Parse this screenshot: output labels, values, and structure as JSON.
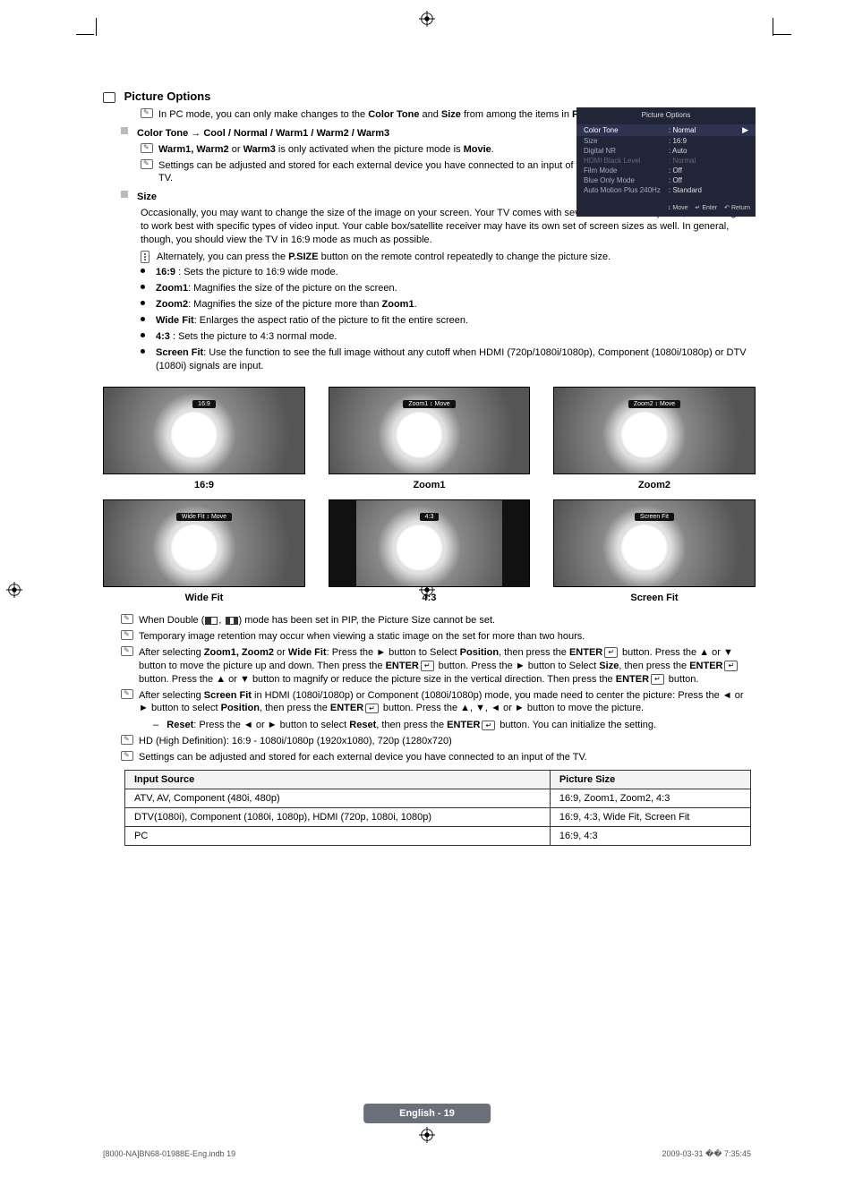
{
  "heading": "Picture Options",
  "intro_note": {
    "pre": "In PC mode, you can only make changes to the ",
    "b1": "Color Tone",
    "mid": " and ",
    "b2": "Size",
    "post": " from among the items in ",
    "b3": "Picture Options",
    "end": "."
  },
  "color_tone_heading": "Color Tone → Cool / Normal / Warm1 / Warm2 / Warm3",
  "ct_note1": {
    "b": "Warm1, Warm2",
    "mid": " or ",
    "b2": "Warm3",
    "post": " is only activated when the picture mode is ",
    "b3": "Movie",
    "end": "."
  },
  "ct_note2": "Settings can be adjusted and stored for each external device you have connected to an input of the TV.",
  "size_heading": "Size",
  "size_para": "Occasionally, you may want to change the size of the image on your screen. Your TV comes with several screen size options, each designed to work best with specific types of video input. Your cable box/satellite receiver may have its own set of screen sizes as well. In general, though, you should view the TV in 16:9 mode as much as possible.",
  "size_remote": {
    "pre": "Alternately, you can press the ",
    "b": "P.SIZE",
    "post": " button on the remote control repeatedly to change the picture size."
  },
  "bullets": [
    {
      "b": "16:9",
      "t": " : Sets the picture to 16:9 wide mode."
    },
    {
      "b": "Zoom1",
      "t": ": Magnifies the size of the picture on the screen."
    },
    {
      "b": "Zoom2",
      "t": ": Magnifies the size of the picture more than ",
      "b2": "Zoom1",
      "t2": "."
    },
    {
      "b": "Wide Fit",
      "t": ": Enlarges the aspect ratio of the picture to fit the entire screen."
    },
    {
      "b": "4:3",
      "t": " : Sets the picture to 4:3 normal mode."
    },
    {
      "b": "Screen Fit",
      "t": ": Use the function to see the full image without any cutoff when HDMI (720p/1080i/1080p), Component (1080i/1080p) or DTV (1080i) signals are input."
    }
  ],
  "thumbs": [
    [
      {
        "badge": "16:9",
        "cap": "16:9",
        "narrow": false
      },
      {
        "badge": "Zoom1 ↕ Move",
        "cap": "Zoom1",
        "narrow": false
      },
      {
        "badge": "Zoom2 ↕ Move",
        "cap": "Zoom2",
        "narrow": false
      }
    ],
    [
      {
        "badge": "Wide Fit ↕ Move",
        "cap": "Wide Fit",
        "narrow": false
      },
      {
        "badge": "4:3",
        "cap": "4:3",
        "narrow": true
      },
      {
        "badge": "Screen Fit",
        "cap": "Screen Fit",
        "narrow": false
      }
    ]
  ],
  "notes": {
    "n1_a": "When Double (",
    "n1_b": ") mode has been set in PIP, the Picture Size cannot be set.",
    "n2": "Temporary image retention may occur when viewing a static image on the set for more than two hours.",
    "n3_a": "After selecting ",
    "n3_b": "Zoom1, Zoom2",
    "n3_c": " or ",
    "n3_d": "Wide Fit",
    "n3_e": ": Press the ► button to Select ",
    "n3_f": "Position",
    "n3_g": ", then press the ",
    "n3_h": "ENTER",
    "n3_i": " button. Press the ▲ or ▼ button to move the picture up and down. Then press the ",
    "n3_j": " button. Press the ► button to Select ",
    "n3_k": "Size",
    "n3_l": ", then press the ",
    "n3_m": " button. Press the ▲ or ▼ button to magnify or reduce the picture size in the vertical direction. Then press the ",
    "n3_n": " button.",
    "n4_a": "After selecting ",
    "n4_b": "Screen Fit",
    "n4_c": " in HDMI (1080i/1080p) or Component (1080i/1080p) mode, you made need to center the picture: Press the ◄ or ► button to select ",
    "n4_d": "Position",
    "n4_e": ", then press the ",
    "n4_f": " button. Press the ▲, ▼, ◄ or ► button to move the picture.",
    "reset_a": "Reset",
    "reset_b": ": Press the ◄ or ► button to select ",
    "reset_c": "Reset",
    "reset_d": ", then press the ",
    "reset_e": " button. You can initialize the setting.",
    "n5": "HD (High Definition): 16:9 - 1080i/1080p (1920x1080), 720p (1280x720)",
    "n6": "Settings can be adjusted and stored for each external device you have connected to an input of the TV."
  },
  "table": {
    "h1": "Input Source",
    "h2": "Picture Size",
    "rows": [
      {
        "a": "ATV, AV, Component (480i, 480p)",
        "b": "16:9, Zoom1, Zoom2, 4:3"
      },
      {
        "a": "DTV(1080i), Component (1080i, 1080p), HDMI (720p, 1080i, 1080p)",
        "b": "16:9, 4:3, Wide Fit, Screen Fit"
      },
      {
        "a": "PC",
        "b": "16:9, 4:3"
      }
    ]
  },
  "menu": {
    "title": "Picture Options",
    "rows": [
      {
        "label": "Color Tone",
        "val": ": Normal",
        "sel": true,
        "dis": false
      },
      {
        "label": "Size",
        "val": ": 16:9",
        "sel": false,
        "dis": false
      },
      {
        "label": "Digital NR",
        "val": ": Auto",
        "sel": false,
        "dis": false
      },
      {
        "label": "HDMI Black Level",
        "val": ": Normal",
        "sel": false,
        "dis": true
      },
      {
        "label": "Film Mode",
        "val": ": Off",
        "sel": false,
        "dis": false
      },
      {
        "label": "Blue Only Mode",
        "val": ": Off",
        "sel": false,
        "dis": false
      },
      {
        "label": "Auto Motion Plus 240Hz",
        "val": ": Standard",
        "sel": false,
        "dis": false
      }
    ],
    "footer": [
      {
        "icon": "↕",
        "label": "Move"
      },
      {
        "icon": "↵",
        "label": "Enter"
      },
      {
        "icon": "↶",
        "label": "Return"
      }
    ]
  },
  "page_label": "English - 19",
  "doc_foot_left": "[8000-NA]BN68-01988E-Eng.indb   19",
  "doc_foot_right": "2009-03-31   �� 7:35:45"
}
